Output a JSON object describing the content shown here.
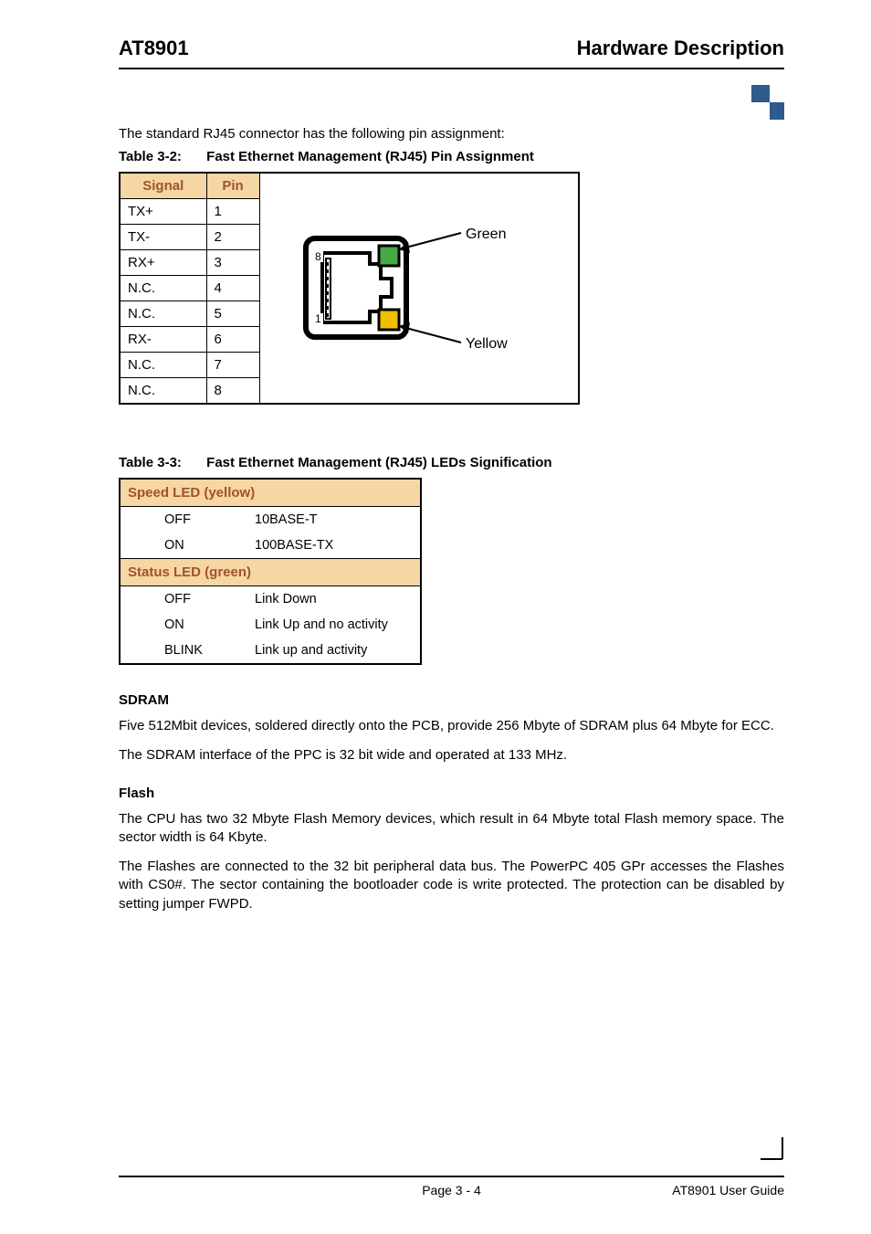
{
  "header": {
    "left": "AT8901",
    "right": "Hardware Description"
  },
  "intro": "The standard RJ45 connector has the following pin assignment:",
  "table32": {
    "caption_num": "Table 3-2:",
    "caption_text": "Fast Ethernet Management (RJ45) Pin Assignment",
    "headers": [
      "Signal",
      "Pin"
    ],
    "rows": [
      {
        "signal": "TX+",
        "pin": "1"
      },
      {
        "signal": "TX-",
        "pin": "2"
      },
      {
        "signal": "RX+",
        "pin": "3"
      },
      {
        "signal": "N.C.",
        "pin": "4"
      },
      {
        "signal": "N.C.",
        "pin": "5"
      },
      {
        "signal": "RX-",
        "pin": "6"
      },
      {
        "signal": "N.C.",
        "pin": "7"
      },
      {
        "signal": "N.C.",
        "pin": "8"
      }
    ],
    "diagram": {
      "label_green": "Green",
      "label_yellow": "Yellow",
      "pin8": "8",
      "pin1": "1"
    }
  },
  "table33": {
    "caption_num": "Table 3-3:",
    "caption_text": "Fast Ethernet Management (RJ45) LEDs Signification",
    "speed_header": "Speed LED (yellow)",
    "status_header": "Status LED (green)",
    "speed_rows": [
      {
        "state": "OFF",
        "meaning": "10BASE-T"
      },
      {
        "state": "ON",
        "meaning": "100BASE-TX"
      }
    ],
    "status_rows": [
      {
        "state": "OFF",
        "meaning": "Link Down"
      },
      {
        "state": "ON",
        "meaning": "Link Up and no activity"
      },
      {
        "state": "BLINK",
        "meaning": "Link up and activity"
      }
    ]
  },
  "sdram": {
    "heading": "SDRAM",
    "p1": "Five 512Mbit devices, soldered directly onto the PCB, provide 256 Mbyte of SDRAM plus 64 Mbyte for ECC.",
    "p2": "The SDRAM interface of the PPC is 32 bit wide and operated at 133 MHz."
  },
  "flash": {
    "heading": "Flash",
    "p1": "The CPU has two 32 Mbyte Flash Memory devices, which result in 64 Mbyte total Flash memory space. The sector width is 64 Kbyte.",
    "p2": "The Flashes are connected to the 32 bit peripheral data bus. The PowerPC 405 GPr accesses the Flashes with CS0#. The sector containing the bootloader code is write protected. The protection can be disabled by setting jumper FWPD."
  },
  "footer": {
    "center": "Page 3 - 4",
    "right": "AT8901 User Guide"
  }
}
